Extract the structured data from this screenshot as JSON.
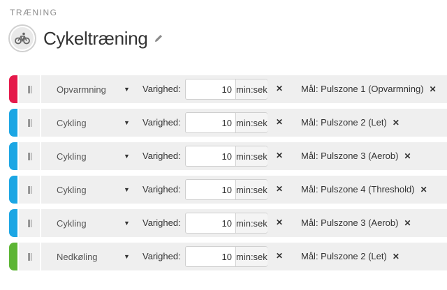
{
  "header": {
    "section_label": "TRÆNING",
    "title": "Cykeltræning",
    "avatar_icon": "bicycle-icon",
    "edit_icon": "pencil-icon"
  },
  "labels": {
    "duration": "Varighed:",
    "unit": "min:sek",
    "remove_glyph": "✕"
  },
  "colors": {
    "red": "#e5194a",
    "blue": "#1ba6e4",
    "green": "#5cb533"
  },
  "steps": [
    {
      "type": "Opvarmning",
      "duration": "10",
      "goal": "Mål: Pulszone 1 (Opvarmning)",
      "accent": "#e5194a"
    },
    {
      "type": "Cykling",
      "duration": "10",
      "goal": "Mål: Pulszone 2 (Let)",
      "accent": "#1ba6e4"
    },
    {
      "type": "Cykling",
      "duration": "10",
      "goal": "Mål: Pulszone 3 (Aerob)",
      "accent": "#1ba6e4"
    },
    {
      "type": "Cykling",
      "duration": "10",
      "goal": "Mål: Pulszone 4 (Threshold)",
      "accent": "#1ba6e4"
    },
    {
      "type": "Cykling",
      "duration": "10",
      "goal": "Mål: Pulszone 3 (Aerob)",
      "accent": "#1ba6e4"
    },
    {
      "type": "Nedkøling",
      "duration": "10",
      "goal": "Mål: Pulszone 2 (Let)",
      "accent": "#5cb533"
    }
  ]
}
